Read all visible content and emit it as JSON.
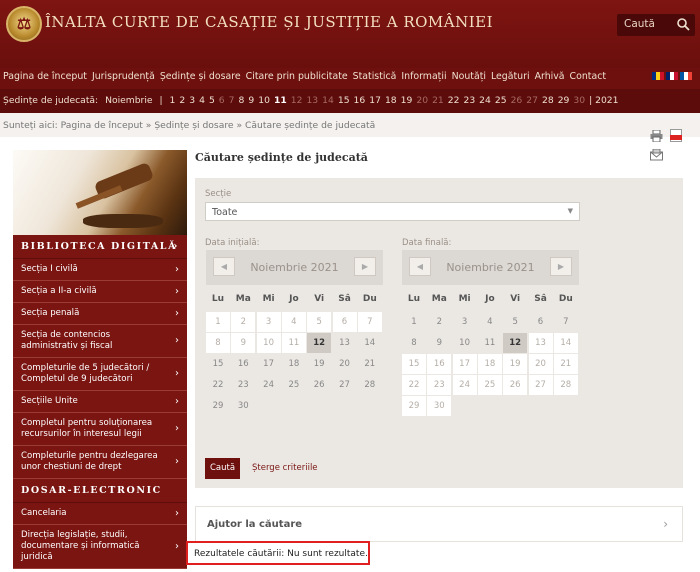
{
  "header": {
    "title": "ÎNALTA CURTE DE CASAȚIE ȘI JUSTIȚIE A ROMÂNIEI",
    "search_label": "Caută"
  },
  "nav": {
    "items": [
      "Pagina de început",
      "Jurisprudență",
      "Ședințe și dosare",
      "Citare prin publicitate",
      "Statistică",
      "Informații",
      "Noutăți",
      "Legături",
      "Arhivă",
      "Contact"
    ],
    "flags": [
      "ro-flag-icon",
      "uk-flag-icon",
      "fr-flag-icon"
    ]
  },
  "sedinte": {
    "label": "Ședințe de judecată:",
    "month": "Noiembrie",
    "sep": "|",
    "year_sep": "| 2021",
    "days": [
      {
        "d": "1",
        "s": "n"
      },
      {
        "d": "2",
        "s": "n"
      },
      {
        "d": "3",
        "s": "n"
      },
      {
        "d": "4",
        "s": "n"
      },
      {
        "d": "5",
        "s": "n"
      },
      {
        "d": "6",
        "s": "dim"
      },
      {
        "d": "7",
        "s": "dim"
      },
      {
        "d": "8",
        "s": "n"
      },
      {
        "d": "9",
        "s": "n"
      },
      {
        "d": "10",
        "s": "n"
      },
      {
        "d": "11",
        "s": "cur"
      },
      {
        "d": "12",
        "s": "dim"
      },
      {
        "d": "13",
        "s": "dim"
      },
      {
        "d": "14",
        "s": "dim"
      },
      {
        "d": "15",
        "s": "n"
      },
      {
        "d": "16",
        "s": "n"
      },
      {
        "d": "17",
        "s": "n"
      },
      {
        "d": "18",
        "s": "n"
      },
      {
        "d": "19",
        "s": "n"
      },
      {
        "d": "20",
        "s": "dim"
      },
      {
        "d": "21",
        "s": "dim"
      },
      {
        "d": "22",
        "s": "n"
      },
      {
        "d": "23",
        "s": "n"
      },
      {
        "d": "24",
        "s": "n"
      },
      {
        "d": "25",
        "s": "n"
      },
      {
        "d": "26",
        "s": "dim"
      },
      {
        "d": "27",
        "s": "dim"
      },
      {
        "d": "28",
        "s": "n"
      },
      {
        "d": "29",
        "s": "n"
      },
      {
        "d": "30",
        "s": "dim"
      }
    ]
  },
  "breadcrumb": "Sunteți aici: Pagina de început » Ședințe și dosare » Căutare ședințe de judecată",
  "tools": [
    "print-icon",
    "pdf-icon",
    "email-icon"
  ],
  "sidebar": {
    "sections": [
      {
        "heading": "BIBLIOTECA DIGITALĂ",
        "items": [
          "Secția I civilă",
          "Secția a II-a civilă",
          "Secția penală",
          "Secția de contencios administrativ și fiscal",
          "Completurile de 5 judecători / Completul de 9 judecători",
          "Secțiile Unite",
          "Completul pentru soluționarea recursurilor în interesul legii",
          "Completurile pentru dezlegarea unor chestiuni de drept"
        ]
      },
      {
        "heading": "DOSAR-ELECTRONIC",
        "items": [
          "Cancelaria",
          "Direcția legislație, studii, documentare și informatică juridică"
        ]
      }
    ]
  },
  "main": {
    "title": "Căutare ședințe de judecată",
    "section_label": "Secție",
    "section_value": "Toate",
    "date_start_label": "Data inițială:",
    "date_end_label": "Data finală:",
    "calendar_month": "Noiembrie 2021",
    "weekdays": [
      "Lu",
      "Ma",
      "Mi",
      "Jo",
      "Vi",
      "Sâ",
      "Du"
    ],
    "search_button": "Caută",
    "clear_link": "Șterge criteriile",
    "help_title": "Ajutor la căutare",
    "result_text": "Rezultatele căutării: Nu sunt rezultate."
  }
}
